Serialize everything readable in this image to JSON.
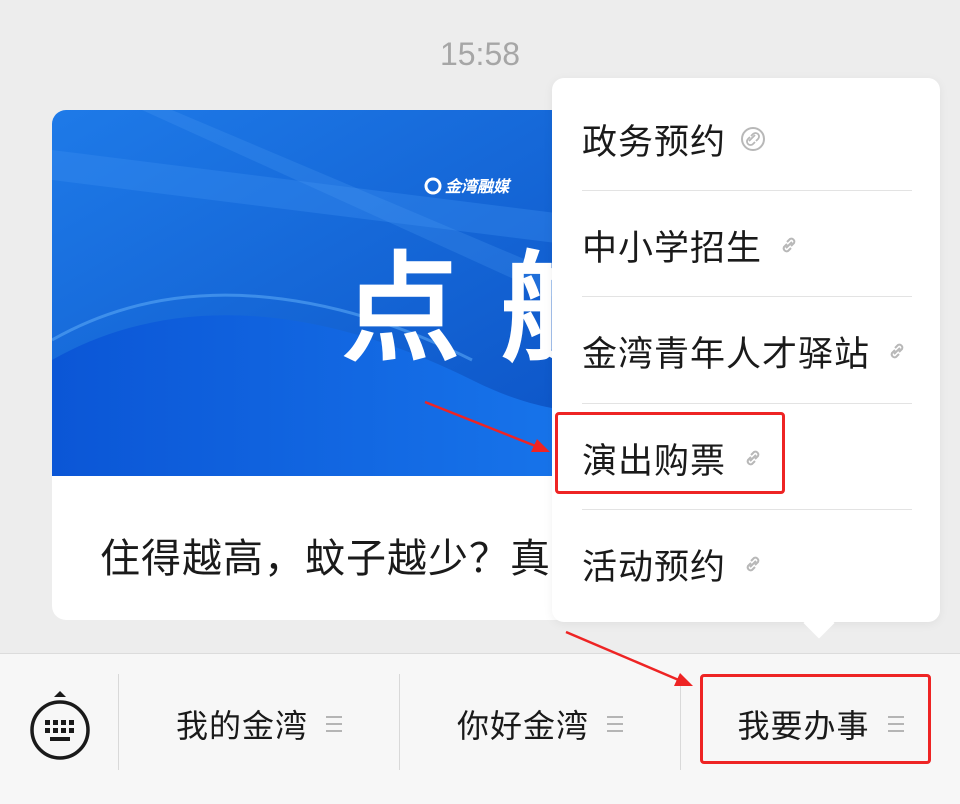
{
  "chat": {
    "timestamp": "15:58",
    "card": {
      "banner_brand": "金湾融媒",
      "banner_headline": "点 航",
      "title": "住得越高，蚊子越少？真"
    }
  },
  "menu": {
    "items": [
      {
        "label": "政务预约",
        "icon": "link-icon"
      },
      {
        "label": "中小学招生",
        "icon": "link-icon"
      },
      {
        "label": "金湾青年人才驿站",
        "icon": "link-icon"
      },
      {
        "label": "演出购票",
        "icon": "link-icon"
      },
      {
        "label": "活动预约",
        "icon": "link-icon"
      }
    ]
  },
  "bottom_bar": {
    "keyboard_icon": "keyboard-icon",
    "tabs": [
      {
        "label": "我的金湾",
        "icon": "menu-lines-icon"
      },
      {
        "label": "你好金湾",
        "icon": "menu-lines-icon"
      },
      {
        "label": "我要办事",
        "icon": "menu-lines-icon"
      }
    ]
  },
  "colors": {
    "background": "#ededed",
    "highlight": "#ee2424",
    "banner_blue": "#1565d8"
  }
}
